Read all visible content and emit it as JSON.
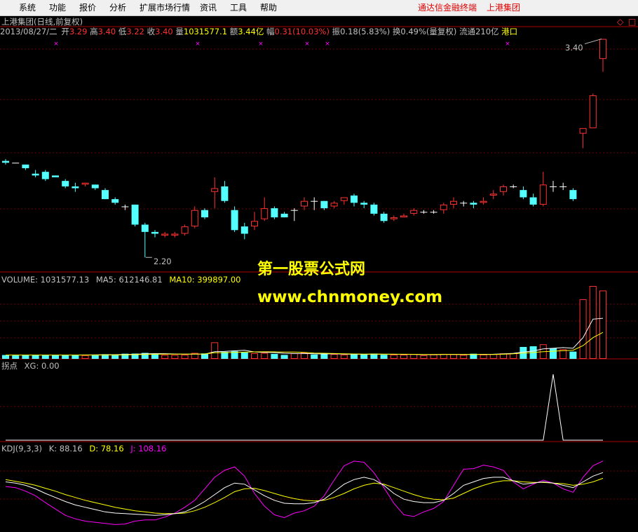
{
  "menu": {
    "items": [
      "系统",
      "功能",
      "报价",
      "分析",
      "扩展市场行情",
      "资讯",
      "工具",
      "帮助"
    ],
    "right_app": "通达信金融终端",
    "right_stock": "上港集团"
  },
  "header": {
    "title": "上港集团(日线,前复权)"
  },
  "quote": {
    "date": "2013/08/27/二",
    "open_label": "开",
    "open": "3.29",
    "high_label": "高",
    "high": "3.40",
    "low_label": "低",
    "low": "3.22",
    "close_label": "收",
    "close": "3.40",
    "volume_label": "量",
    "volume": "1031577.1",
    "amount_label": "额",
    "amount": "3.44亿",
    "change_label": "幅",
    "change": "0.31(10.03%)",
    "amplitude_label": "振",
    "amplitude": "0.18(5.83%)",
    "turnover_label": "换",
    "turnover": "0.49%(量复权)",
    "float_label": "流通",
    "float": "210亿",
    "sector": "港口"
  },
  "price_markers": {
    "high": "3.40",
    "low": "2.20"
  },
  "indicators": {
    "volume_line": "VOLUME: 1031577.13  MA5: 612146.81  MA10: 399897.00",
    "volume_label": "VOLUME: 1031577.13",
    "ma5_label": "MA5: 612146.81",
    "ma10_label": "MA10: 399897.00",
    "xg_name": "拐点",
    "xg_label": "XG: 0.00",
    "kdj_name": "KDJ(9,3,3)",
    "k_label": "K: 88.16",
    "d_label": "D: 78.16",
    "j_label": "J: 108.16"
  },
  "watermark": {
    "line1": "第一股票公式网",
    "line2": "www.chnmoney.com"
  },
  "colors": {
    "up": "#ff3232",
    "down": "#54ffff",
    "ma5": "#ffffff",
    "ma10": "#ffff00",
    "k": "#ffffff",
    "d": "#ffff00",
    "j": "#ff00ff",
    "border": "#b00000",
    "label": "#c0c0c0",
    "watermark": "#ffff00"
  },
  "chart_data": {
    "type": "candlestick",
    "timeframe": "daily",
    "last_date": "2013/08/27",
    "y_range": [
      2.12,
      3.46
    ],
    "candles": [
      [
        2.73,
        2.74,
        2.72,
        2.71
      ],
      [
        2.72,
        2.72,
        2.72,
        2.72
      ],
      [
        2.71,
        2.71,
        2.69,
        2.68
      ],
      [
        2.66,
        2.68,
        2.65,
        2.64
      ],
      [
        2.67,
        2.68,
        2.63,
        2.62
      ],
      [
        2.65,
        2.65,
        2.64,
        2.64
      ],
      [
        2.62,
        2.63,
        2.59,
        2.58
      ],
      [
        2.59,
        2.61,
        2.58,
        2.56
      ],
      [
        2.6,
        2.61,
        2.61,
        2.59
      ],
      [
        2.6,
        2.6,
        2.58,
        2.57
      ],
      [
        2.57,
        2.58,
        2.52,
        2.52
      ],
      [
        2.52,
        2.53,
        2.5,
        2.49
      ],
      [
        2.48,
        2.49,
        2.48,
        2.46
      ],
      [
        2.49,
        2.49,
        2.38,
        2.37
      ],
      [
        2.38,
        2.39,
        2.34,
        2.2
      ],
      [
        2.34,
        2.35,
        2.33,
        2.31
      ],
      [
        2.32,
        2.34,
        2.33,
        2.31
      ],
      [
        2.32,
        2.34,
        2.33,
        2.31
      ],
      [
        2.33,
        2.38,
        2.37,
        2.32
      ],
      [
        2.37,
        2.48,
        2.46,
        2.36
      ],
      [
        2.46,
        2.47,
        2.42,
        2.41
      ],
      [
        2.56,
        2.64,
        2.58,
        2.47
      ],
      [
        2.59,
        2.62,
        2.51,
        2.5
      ],
      [
        2.46,
        2.48,
        2.35,
        2.34
      ],
      [
        2.37,
        2.39,
        2.33,
        2.3
      ],
      [
        2.37,
        2.45,
        2.4,
        2.35
      ],
      [
        2.41,
        2.53,
        2.47,
        2.4
      ],
      [
        2.47,
        2.48,
        2.42,
        2.41
      ],
      [
        2.44,
        2.45,
        2.42,
        2.42
      ],
      [
        2.46,
        2.47,
        2.46,
        2.4
      ],
      [
        2.48,
        2.53,
        2.51,
        2.46
      ],
      [
        2.51,
        2.53,
        2.51,
        2.46
      ],
      [
        2.51,
        2.51,
        2.47,
        2.46
      ],
      [
        2.48,
        2.51,
        2.5,
        2.47
      ],
      [
        2.51,
        2.53,
        2.53,
        2.49
      ],
      [
        2.54,
        2.55,
        2.5,
        2.48
      ],
      [
        2.5,
        2.51,
        2.49,
        2.47
      ],
      [
        2.49,
        2.5,
        2.44,
        2.43
      ],
      [
        2.44,
        2.45,
        2.4,
        2.39
      ],
      [
        2.41,
        2.43,
        2.42,
        2.4
      ],
      [
        2.42,
        2.44,
        2.43,
        2.42
      ],
      [
        2.44,
        2.47,
        2.46,
        2.43
      ],
      [
        2.45,
        2.46,
        2.45,
        2.44
      ],
      [
        2.45,
        2.46,
        2.45,
        2.44
      ],
      [
        2.46,
        2.5,
        2.49,
        2.44
      ],
      [
        2.49,
        2.53,
        2.51,
        2.47
      ],
      [
        2.5,
        2.51,
        2.5,
        2.48
      ],
      [
        2.5,
        2.51,
        2.49,
        2.47
      ],
      [
        2.5,
        2.53,
        2.51,
        2.49
      ],
      [
        2.54,
        2.57,
        2.55,
        2.52
      ],
      [
        2.56,
        2.6,
        2.59,
        2.54
      ],
      [
        2.59,
        2.6,
        2.59,
        2.58
      ],
      [
        2.57,
        2.59,
        2.53,
        2.52
      ],
      [
        2.53,
        2.55,
        2.49,
        2.48
      ],
      [
        2.49,
        2.67,
        2.6,
        2.48
      ],
      [
        2.59,
        2.62,
        2.59,
        2.56
      ],
      [
        2.59,
        2.61,
        2.59,
        2.57
      ],
      [
        2.57,
        2.58,
        2.52,
        2.51
      ],
      [
        2.88,
        2.9,
        2.91,
        2.8
      ],
      [
        2.91,
        3.1,
        3.09,
        2.91
      ],
      [
        3.29,
        3.4,
        3.4,
        3.22
      ]
    ],
    "volume": {
      "y_range": [
        0,
        1100000
      ],
      "values": [
        58000,
        52000,
        60000,
        57000,
        62000,
        58000,
        60000,
        61000,
        55000,
        63000,
        70000,
        64000,
        78000,
        80000,
        90000,
        80000,
        60000,
        60000,
        62000,
        90000,
        82000,
        250000,
        105000,
        115000,
        98000,
        85000,
        90000,
        75000,
        60000,
        85000,
        95000,
        66000,
        70000,
        72000,
        65000,
        75000,
        70000,
        80000,
        62000,
        64000,
        63000,
        72000,
        55000,
        66000,
        75000,
        70000,
        60000,
        78000,
        65000,
        72000,
        82000,
        85000,
        180000,
        190000,
        220000,
        160000,
        145000,
        110000,
        900000,
        1400000,
        1031577
      ],
      "up_flags": [
        0,
        0,
        0,
        0,
        0,
        0,
        0,
        0,
        1,
        0,
        0,
        0,
        0,
        0,
        0,
        0,
        1,
        1,
        1,
        1,
        0,
        1,
        0,
        0,
        0,
        1,
        1,
        0,
        0,
        1,
        1,
        0,
        0,
        1,
        1,
        0,
        0,
        0,
        0,
        1,
        1,
        1,
        1,
        1,
        1,
        1,
        1,
        0,
        1,
        1,
        1,
        1,
        0,
        0,
        1,
        0,
        1,
        0,
        1,
        1,
        1
      ],
      "ma5": [
        58000,
        58000,
        58000,
        58000,
        58000,
        58000,
        58000,
        58000,
        59000,
        60000,
        62000,
        63000,
        66000,
        70000,
        75000,
        79000,
        78000,
        74000,
        72000,
        72000,
        72000,
        108000,
        112000,
        122000,
        130000,
        105000,
        98000,
        95000,
        85000,
        80000,
        80000,
        76000,
        74000,
        76000,
        72000,
        70000,
        70000,
        72000,
        70000,
        70000,
        68000,
        68000,
        63000,
        64000,
        67000,
        68000,
        66000,
        68000,
        69000,
        70000,
        75000,
        84000,
        104000,
        120000,
        150000,
        160000,
        170000,
        160000,
        320000,
        600000,
        612147
      ],
      "ma10": [
        58000,
        58000,
        58000,
        58000,
        58000,
        58000,
        58000,
        58000,
        58000,
        58000,
        59000,
        59000,
        61000,
        64000,
        67000,
        70000,
        71000,
        71000,
        72000,
        73000,
        74000,
        92000,
        94000,
        98000,
        102000,
        106000,
        107000,
        106000,
        104000,
        103000,
        98000,
        88000,
        85000,
        80000,
        76000,
        74000,
        72000,
        73000,
        71000,
        70000,
        70000,
        69000,
        67000,
        66000,
        68000,
        68000,
        67000,
        68000,
        67000,
        67000,
        70000,
        76000,
        88000,
        96000,
        108000,
        115000,
        124000,
        130000,
        200000,
        320000,
        399897
      ]
    },
    "xg": {
      "y_range": [
        0,
        1
      ],
      "values": [
        0,
        0,
        0,
        0,
        0,
        0,
        0,
        0,
        0,
        0,
        0,
        0,
        0,
        0,
        0,
        0,
        0,
        0,
        0,
        0,
        0,
        0,
        0,
        0,
        0,
        0,
        0,
        0,
        0,
        0,
        0,
        0,
        0,
        0,
        0,
        0,
        0,
        0,
        0,
        0,
        0,
        0,
        0,
        0,
        0,
        0,
        0,
        0,
        0,
        0,
        0,
        0,
        0,
        0,
        0,
        1,
        0,
        0,
        0,
        0,
        0
      ]
    },
    "kdj": {
      "y_range": [
        -10,
        120
      ],
      "k": [
        72,
        70,
        66,
        60,
        52,
        45,
        38,
        32,
        28,
        24,
        20,
        18,
        17,
        16,
        15,
        14,
        15,
        17,
        20,
        28,
        38,
        50,
        62,
        70,
        68,
        58,
        48,
        40,
        35,
        34,
        34,
        36,
        42,
        55,
        68,
        76,
        80,
        76,
        66,
        52,
        42,
        38,
        36,
        36,
        40,
        52,
        66,
        72,
        78,
        80,
        80,
        74,
        68,
        70,
        72,
        70,
        66,
        62,
        72,
        82,
        88.16
      ],
      "d": [
        76,
        73,
        70,
        66,
        61,
        56,
        50,
        45,
        40,
        36,
        32,
        28,
        25,
        22,
        20,
        18,
        17,
        17,
        18,
        22,
        28,
        36,
        45,
        55,
        60,
        61,
        57,
        52,
        47,
        43,
        40,
        39,
        40,
        45,
        52,
        60,
        66,
        70,
        68,
        62,
        56,
        50,
        45,
        42,
        41,
        44,
        52,
        60,
        66,
        71,
        74,
        74,
        72,
        71,
        71,
        70,
        69,
        66,
        68,
        72,
        78.16
      ],
      "j": [
        64,
        62,
        56,
        48,
        36,
        25,
        14,
        8,
        4,
        2,
        0,
        -2,
        -1,
        4,
        6,
        6,
        11,
        18,
        28,
        40,
        60,
        80,
        92,
        98,
        82,
        52,
        30,
        15,
        10,
        18,
        22,
        30,
        48,
        75,
        100,
        108,
        106,
        88,
        62,
        35,
        15,
        12,
        20,
        26,
        38,
        66,
        94,
        95,
        101,
        98,
        92,
        72,
        60,
        68,
        75,
        70,
        60,
        54,
        80,
        100,
        108.16
      ]
    }
  }
}
